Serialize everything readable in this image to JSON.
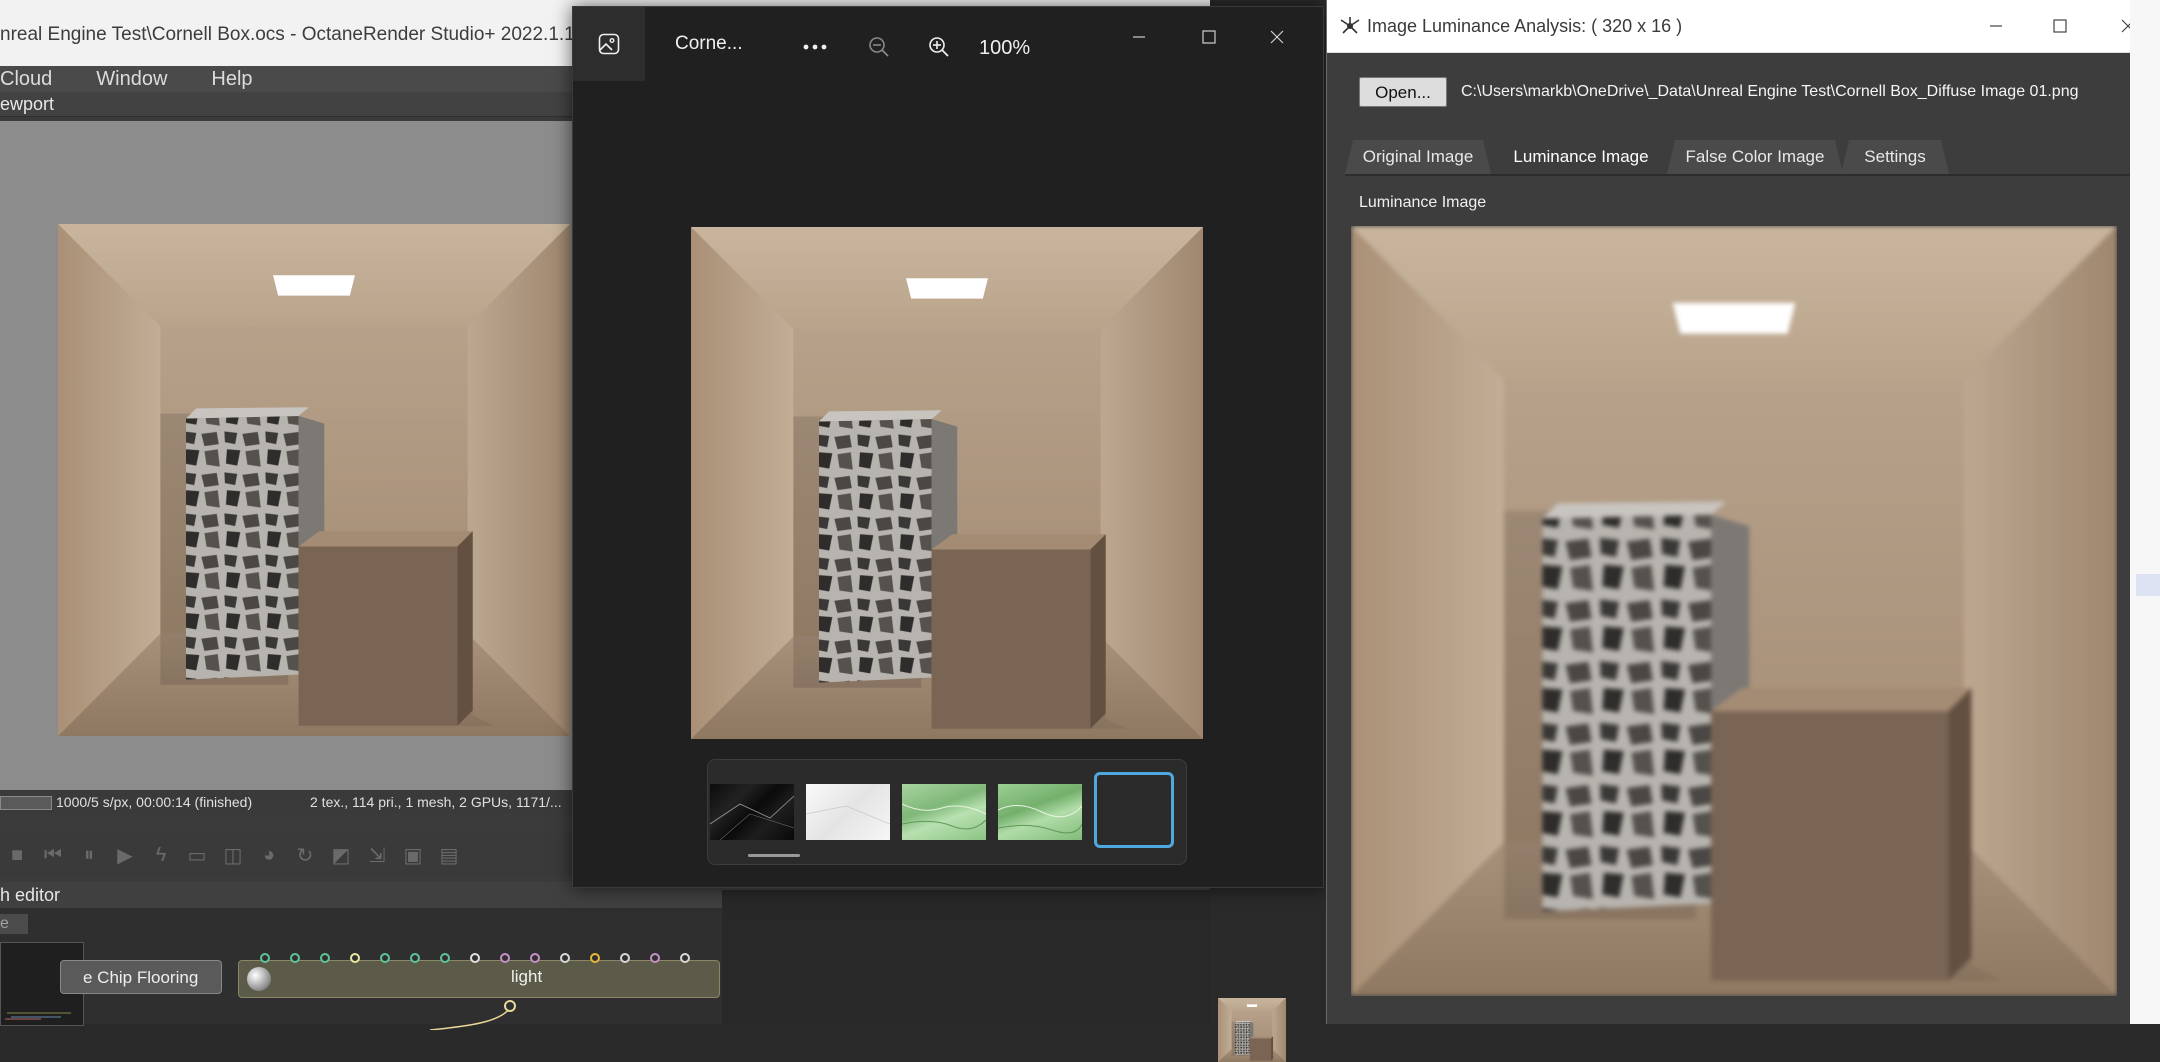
{
  "octane": {
    "title": "nreal Engine Test\\Cornell Box.ocs - OctaneRender Studio+ 2022.1.1",
    "menu": [
      "Cloud",
      "Window",
      "Help"
    ],
    "viewport_label": "ewport",
    "status_time": "1000/5 s/px, 00:00:14 (finished)",
    "status_info": "2 tex., 114 pri., 1 mesh, 2 GPUs, 1171/...",
    "editor_label": "h editor",
    "editor_tab": "e",
    "node_flooring": "e Chip Flooring",
    "node_light": "light"
  },
  "photos": {
    "filename": "Corne...",
    "zoom": "100%",
    "more_icon": "more-icon",
    "thumbnails": [
      "black-marble",
      "white-marble",
      "green-texture-1",
      "green-texture-2",
      "cornell-box"
    ],
    "selected_thumbnail": 4
  },
  "luminance": {
    "title": "Image Luminance Analysis:  ( 320 x 16 )",
    "open_label": "Open...",
    "path": "C:\\Users\\markb\\OneDrive\\_Data\\Unreal Engine Test\\Cornell Box_Diffuse Image 01.png",
    "tabs": [
      "Original Image",
      "Luminance Image",
      "False Color Image",
      "Settings"
    ],
    "active_tab": 1,
    "image_label": "Luminance Image"
  },
  "colors": {
    "photos_selection": "#4fa8de",
    "wood": "#b49a80",
    "pin_colors": [
      "#5ec59a",
      "#5ec59a",
      "#5ec59a",
      "#e8e8a0",
      "#5ec59a",
      "#5ec59a",
      "#5ec59a",
      "#e0e0e0",
      "#c890c8",
      "#c890c8",
      "#d8d8d8",
      "#e8b838",
      "#d8d8d8",
      "#c890c8",
      "#d8d8d8"
    ]
  }
}
